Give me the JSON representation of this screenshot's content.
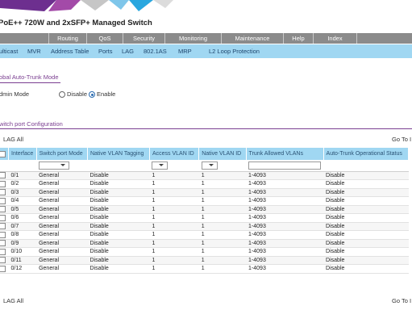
{
  "header": {
    "product_title": "PoE++ 720W and 2xSFP+ Managed Switch"
  },
  "main_nav": [
    {
      "label": "Routing"
    },
    {
      "label": "QoS"
    },
    {
      "label": "Security"
    },
    {
      "label": "Monitoring"
    },
    {
      "label": "Maintenance"
    },
    {
      "label": "Help"
    },
    {
      "label": "Index"
    }
  ],
  "sub_nav": [
    {
      "label": "ulticast"
    },
    {
      "label": "MVR"
    },
    {
      "label": "Address Table"
    },
    {
      "label": "Ports"
    },
    {
      "label": "LAG"
    },
    {
      "label": "802.1AS"
    },
    {
      "label": "MRP"
    },
    {
      "label": "L2 Loop Protection"
    }
  ],
  "global": {
    "title": "obal Auto-Trunk Mode",
    "admin_mode_label": "dmin Mode",
    "disable_label": "Disable",
    "enable_label": "Enable",
    "selected": "Enable"
  },
  "switchport": {
    "title": "witch port Configuration",
    "lag_all_top": "LAG All",
    "goto_top": "Go To I",
    "lag_all_bottom": "LAG All",
    "goto_bottom": "Go To I",
    "columns": [
      "Interface",
      "Switch port Mode",
      "Native VLAN Tagging",
      "Access VLAN ID",
      "Native VLAN ID",
      "Trunk Allowed VLANs",
      "Auto-Trunk Operational Status"
    ],
    "rows": [
      {
        "iface": "0/1",
        "mode": "General",
        "tag": "Disable",
        "access": "1",
        "native": "1",
        "trunk": "1-4093",
        "status": "Disable"
      },
      {
        "iface": "0/2",
        "mode": "General",
        "tag": "Disable",
        "access": "1",
        "native": "1",
        "trunk": "1-4093",
        "status": "Disable"
      },
      {
        "iface": "0/3",
        "mode": "General",
        "tag": "Disable",
        "access": "1",
        "native": "1",
        "trunk": "1-4093",
        "status": "Disable"
      },
      {
        "iface": "0/4",
        "mode": "General",
        "tag": "Disable",
        "access": "1",
        "native": "1",
        "trunk": "1-4093",
        "status": "Disable"
      },
      {
        "iface": "0/5",
        "mode": "General",
        "tag": "Disable",
        "access": "1",
        "native": "1",
        "trunk": "1-4093",
        "status": "Disable"
      },
      {
        "iface": "0/6",
        "mode": "General",
        "tag": "Disable",
        "access": "1",
        "native": "1",
        "trunk": "1-4093",
        "status": "Disable"
      },
      {
        "iface": "0/7",
        "mode": "General",
        "tag": "Disable",
        "access": "1",
        "native": "1",
        "trunk": "1-4093",
        "status": "Disable"
      },
      {
        "iface": "0/8",
        "mode": "General",
        "tag": "Disable",
        "access": "1",
        "native": "1",
        "trunk": "1-4093",
        "status": "Disable"
      },
      {
        "iface": "0/9",
        "mode": "General",
        "tag": "Disable",
        "access": "1",
        "native": "1",
        "trunk": "1-4093",
        "status": "Disable"
      },
      {
        "iface": "0/10",
        "mode": "General",
        "tag": "Disable",
        "access": "1",
        "native": "1",
        "trunk": "1-4093",
        "status": "Disable"
      },
      {
        "iface": "0/11",
        "mode": "General",
        "tag": "Disable",
        "access": "1",
        "native": "1",
        "trunk": "1-4093",
        "status": "Disable"
      },
      {
        "iface": "0/12",
        "mode": "General",
        "tag": "Disable",
        "access": "1",
        "native": "1",
        "trunk": "1-4093",
        "status": "Disable"
      }
    ]
  },
  "colors": {
    "nav_gray": "#8b8b8b",
    "subnav_blue": "#a0d7f2",
    "accent_purple": "#7b3f91",
    "banner_purple": "#6d2f8f",
    "banner_blue": "#2aa7df"
  }
}
